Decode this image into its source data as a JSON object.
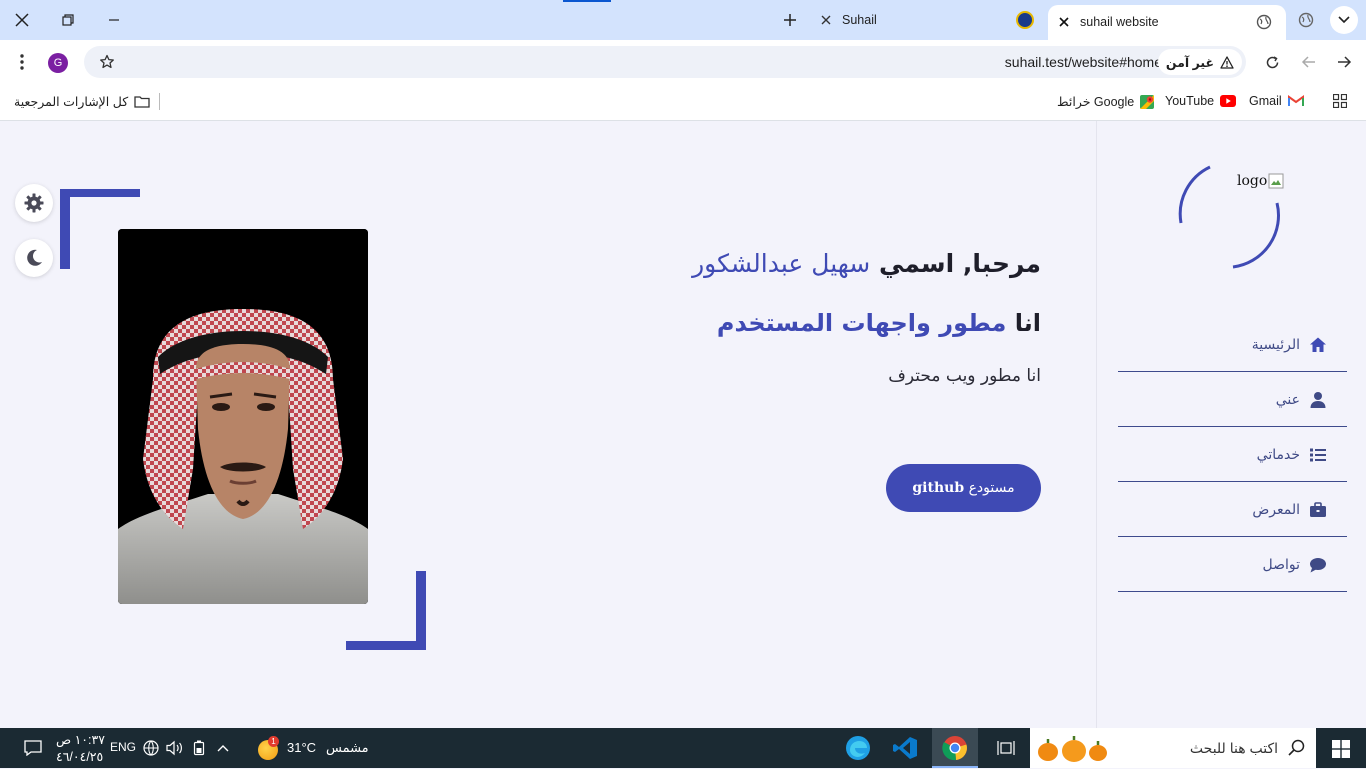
{
  "browser": {
    "tabs": [
      {
        "title": "suhail website",
        "active": true
      },
      {
        "title": "Suhail",
        "active": false
      }
    ],
    "profile_initial": "G",
    "security_label": "غير آمن",
    "url": "suhail.test/website#home",
    "bookmarks": [
      {
        "label": "Gmail",
        "icon": "gmail-icon"
      },
      {
        "label": "YouTube",
        "icon": "youtube-icon"
      },
      {
        "label": "خرائط Google",
        "icon": "maps-icon"
      }
    ],
    "all_bookmarks_label": "كل الإشارات المرجعية"
  },
  "site": {
    "logo_alt": "logo",
    "nav": [
      {
        "label": "الرئيسية",
        "icon": "home-icon",
        "active": true
      },
      {
        "label": "عني",
        "icon": "user-icon"
      },
      {
        "label": "خدماتي",
        "icon": "list-icon"
      },
      {
        "label": "المعرض",
        "icon": "briefcase-icon"
      },
      {
        "label": "تواصل",
        "icon": "chat-icon"
      }
    ],
    "hero": {
      "greeting_prefix": "مرحبا, اسمي",
      "name": "سهيل عبدالشكور",
      "role_prefix": "انا",
      "role": "مطور واجهات المستخدم",
      "tagline": "انا مطور ويب محترف",
      "button_prefix": "مستودع",
      "button_brand": "github"
    },
    "accent_color": "#3f4ab4"
  },
  "taskbar": {
    "search_placeholder": "اكتب هنا للبحث",
    "weather_temp": "31°C",
    "weather_desc": "مشمس",
    "weather_badge": "1",
    "language": "ENG",
    "time": "١٠:٣٧ ص",
    "date": "٤٦/٠٤/٢٥"
  }
}
